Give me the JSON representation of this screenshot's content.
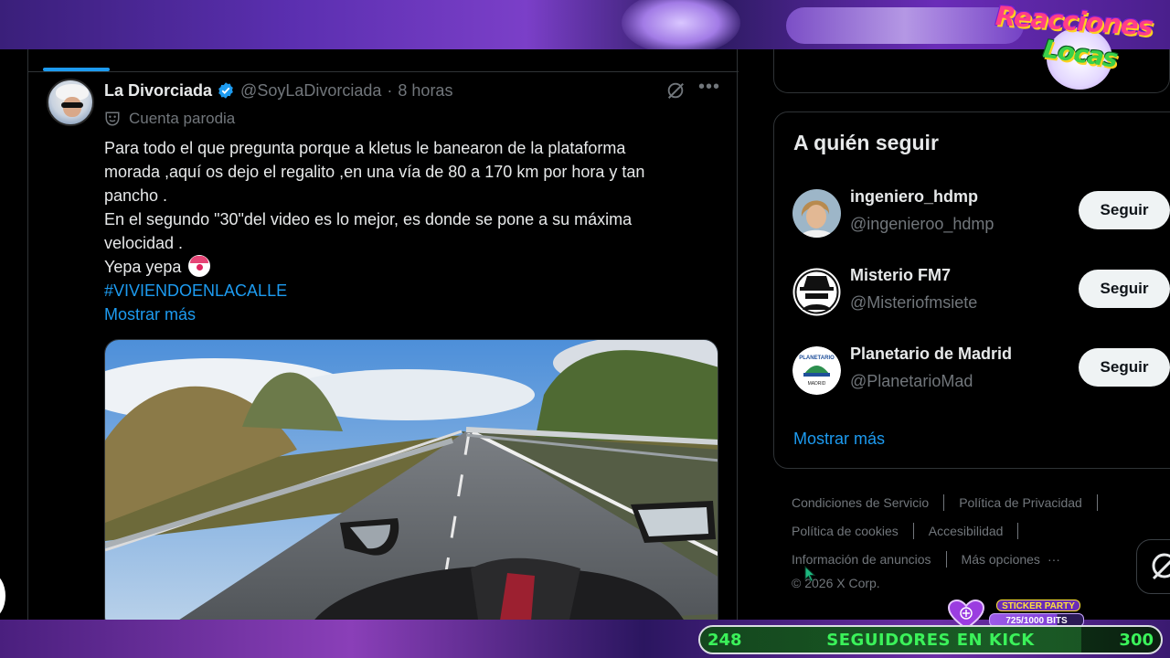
{
  "overlay": {
    "logo_line1": "Reacciones",
    "logo_line2": "Locas",
    "sticker_title": "STICKER PARTY",
    "sticker_bits": "725/1000 BITS",
    "sticker_progress": 0.725,
    "followers_start": "248",
    "followers_label": "SEGUIDORES EN KICK",
    "followers_goal": "300"
  },
  "tweet": {
    "name": "La Divorciada",
    "handle": "@SoyLaDivorciada",
    "dot": "·",
    "time": "8 horas",
    "parody_label": "Cuenta parodia",
    "text_lines": [
      "Para todo el que pregunta porque a kletus le banearon de la plataforma",
      "morada ,aquí os dejo el regalito ,en una vía de 80 a 170 km por hora y tan",
      "pancho .",
      "En el segundo \"30\"del video es lo mejor, es donde se pone a su máxima",
      "velocidad .",
      "Yepa yepa"
    ],
    "hashtag": "#VIVIENDOENLACALLE",
    "show_more": "Mostrar más"
  },
  "who_to_follow": {
    "title": "A quién seguir",
    "items": [
      {
        "name": "ingeniero_hdmp",
        "handle": "@ingenieroo_hdmp",
        "button": "Seguir"
      },
      {
        "name": "Misterio FM7",
        "handle": "@Misteriofmsiete",
        "button": "Seguir"
      },
      {
        "name": "Planetario de Madrid",
        "handle": "@PlanetarioMad",
        "button": "Seguir"
      }
    ],
    "show_more": "Mostrar más"
  },
  "footer": {
    "terms": "Condiciones de Servicio",
    "privacy": "Política de Privacidad",
    "cookies": "Política de cookies",
    "accessibility": "Accesibilidad",
    "ads_info": "Información de anuncios",
    "more_options": "Más opciones",
    "more_dots": "···",
    "copyright": "© 2026 X Corp."
  },
  "planetario_logo_top": "PLANETARIO",
  "planetario_logo_bottom": "MADRID",
  "colors": {
    "accent": "#1d9bf0",
    "text_primary": "#e7e9ea",
    "text_secondary": "#71767b",
    "border": "#2f3336",
    "follow_green": "#3bf25a"
  }
}
